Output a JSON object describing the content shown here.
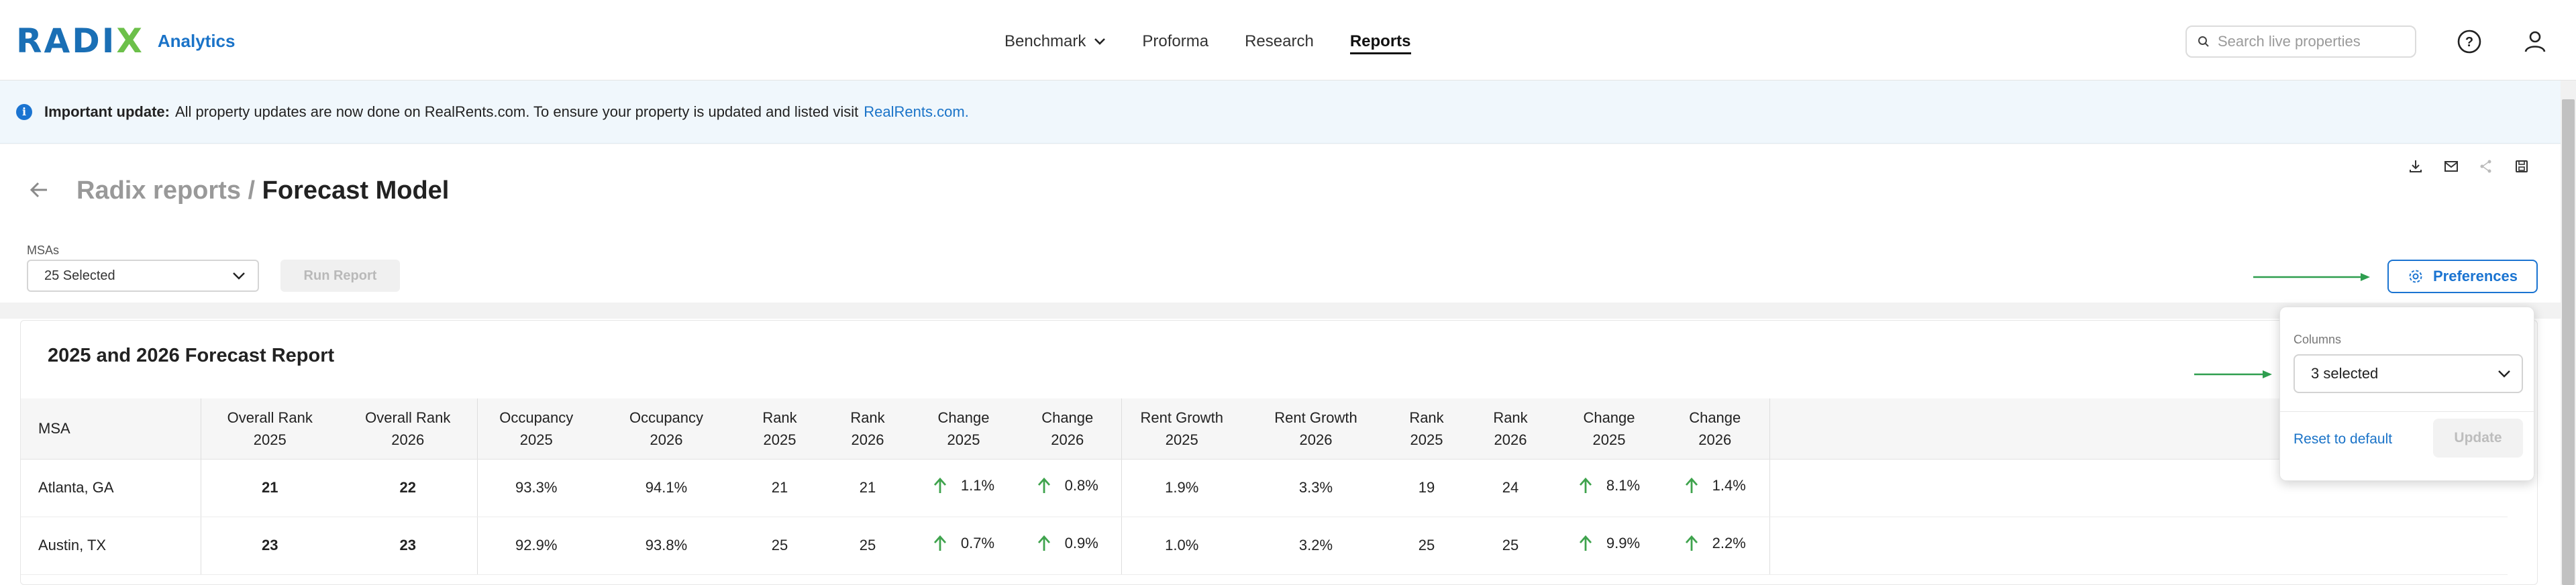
{
  "header": {
    "logo_text": "RADIX",
    "logo_sub": "Analytics",
    "nav": [
      {
        "label": "Benchmark",
        "has_dropdown": true
      },
      {
        "label": "Proforma"
      },
      {
        "label": "Research"
      },
      {
        "label": "Reports",
        "active": true
      }
    ],
    "search_placeholder": "Search live properties",
    "icons": [
      "search-icon",
      "help-icon",
      "user-icon"
    ]
  },
  "banner": {
    "strong": "Important update:",
    "text": "All property updates are now done on RealRents.com. To ensure your property is updated and listed visit",
    "link": "RealRents.com."
  },
  "page": {
    "breadcrumb": "Radix reports /",
    "title": "Forecast Model",
    "toolbar_icons": [
      "download-icon",
      "mail-icon",
      "share-icon",
      "save-icon"
    ]
  },
  "filters": {
    "msa_label": "MSAs",
    "msa_value": "25 Selected",
    "run_label": "Run Report",
    "preferences_label": "Preferences"
  },
  "report": {
    "title": "2025 and 2026 Forecast Report",
    "columns": [
      {
        "l1": "MSA",
        "l2": ""
      },
      {
        "l1": "Overall Rank",
        "l2": "2025"
      },
      {
        "l1": "Overall Rank",
        "l2": "2026"
      },
      {
        "l1": "Occupancy",
        "l2": "2025"
      },
      {
        "l1": "Occupancy",
        "l2": "2026"
      },
      {
        "l1": "Rank",
        "l2": "2025"
      },
      {
        "l1": "Rank",
        "l2": "2026"
      },
      {
        "l1": "Change",
        "l2": "2025"
      },
      {
        "l1": "Change",
        "l2": "2026"
      },
      {
        "l1": "Rent Growth",
        "l2": "2025"
      },
      {
        "l1": "Rent Growth",
        "l2": "2026"
      },
      {
        "l1": "Rank",
        "l2": "2025"
      },
      {
        "l1": "Rank",
        "l2": "2026"
      },
      {
        "l1": "Change",
        "l2": "2025"
      },
      {
        "l1": "Change",
        "l2": "2026"
      }
    ],
    "rows": [
      {
        "msa": "Atlanta, GA",
        "overall_2025": "21",
        "overall_2026": "22",
        "occ_2025": "93.3%",
        "occ_2026": "94.1%",
        "occ_rank_2025": "21",
        "occ_rank_2026": "21",
        "occ_chg_2025": "1.1%",
        "occ_chg_2026": "0.8%",
        "rent_2025": "1.9%",
        "rent_2026": "3.3%",
        "rent_rank_2025": "19",
        "rent_rank_2026": "24",
        "rent_chg_2025": "8.1%",
        "rent_chg_2026": "1.4%"
      },
      {
        "msa": "Austin, TX",
        "overall_2025": "23",
        "overall_2026": "23",
        "occ_2025": "92.9%",
        "occ_2026": "93.8%",
        "occ_rank_2025": "25",
        "occ_rank_2026": "25",
        "occ_chg_2025": "0.7%",
        "occ_chg_2026": "0.9%",
        "rent_2025": "1.0%",
        "rent_2026": "3.2%",
        "rent_rank_2025": "25",
        "rent_rank_2026": "25",
        "rent_chg_2025": "9.9%",
        "rent_chg_2026": "2.2%"
      }
    ]
  },
  "preferences_panel": {
    "columns_label": "Columns",
    "columns_value": "3 selected",
    "reset_label": "Reset to default",
    "update_label": "Update"
  },
  "colors": {
    "accent": "#1b74d1",
    "up_arrow": "#3fa34d",
    "pointer_arrow": "#2e9e4f"
  }
}
